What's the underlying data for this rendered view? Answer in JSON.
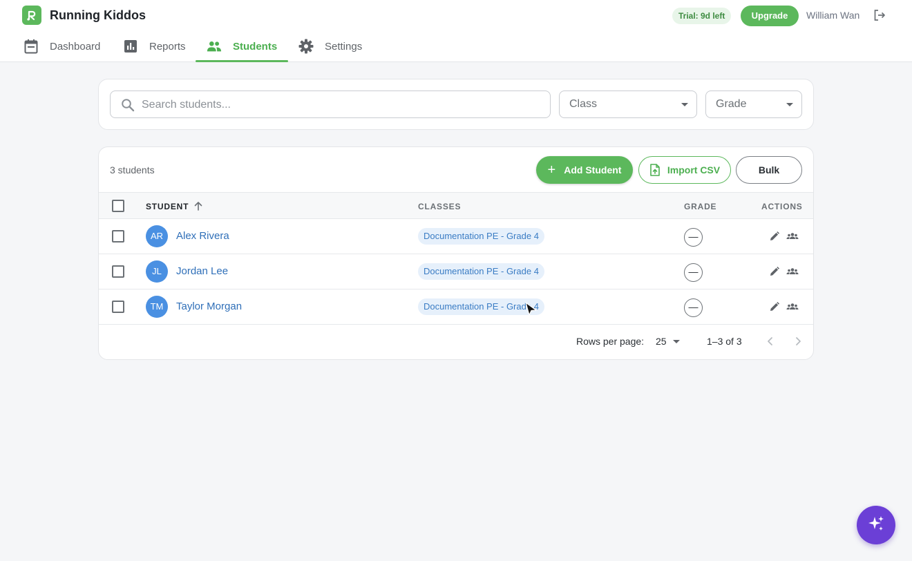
{
  "app": {
    "title": "Running Kiddos"
  },
  "header": {
    "trial_badge": "Trial: 9d left",
    "upgrade_label": "Upgrade",
    "user_name": "William Wan"
  },
  "nav": {
    "tabs": [
      {
        "label": "Dashboard",
        "icon": "calendar-icon",
        "active": false
      },
      {
        "label": "Reports",
        "icon": "bar-chart-icon",
        "active": false
      },
      {
        "label": "Students",
        "icon": "people-icon",
        "active": true
      },
      {
        "label": "Settings",
        "icon": "gear-icon",
        "active": false
      }
    ]
  },
  "filters": {
    "search_placeholder": "Search students...",
    "class_label": "Class",
    "grade_label": "Grade"
  },
  "toolbar": {
    "count": "3 students",
    "add_label": "Add Student",
    "import_label": "Import CSV",
    "bulk_label": "Bulk"
  },
  "table": {
    "columns": [
      "STUDENT",
      "CLASSES",
      "GRADE",
      "ACTIONS"
    ],
    "rows": [
      {
        "initials": "AR",
        "name": "Alex Rivera",
        "class": "Documentation PE - Grade 4",
        "grade": "—"
      },
      {
        "initials": "JL",
        "name": "Jordan Lee",
        "class": "Documentation PE - Grade 4",
        "grade": "—"
      },
      {
        "initials": "TM",
        "name": "Taylor Morgan",
        "class": "Documentation PE - Grade 4",
        "grade": "—"
      }
    ]
  },
  "pagination": {
    "rows_per_page_label": "Rows per page:",
    "rows_per_page": "25",
    "range": "1–3 of 3"
  },
  "colors": {
    "brand_green": "#5cb85c",
    "link_blue": "#2f6fb8",
    "avatar_blue": "#4a90e2",
    "fab_purple": "#6b3fd6"
  }
}
